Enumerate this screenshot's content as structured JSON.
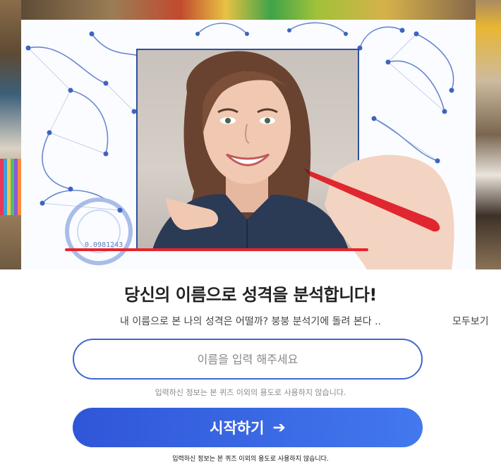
{
  "hero": {
    "gauge_readout": "0.0981243"
  },
  "title": "당신의 이름으로 성격을 분석합니다!",
  "subtitle": "내 이름으로 본 나의 성격은 어떨까? 붕붕 분석기에 돌려 본다 ..",
  "more_link": "모두보기",
  "name_input": {
    "value": "",
    "placeholder": "이름을 입력 해주세요"
  },
  "input_notice": "입력하신 정보는 본 퀴즈 이외의 용도로 사용하지 않습니다.",
  "start_button": {
    "label": "시작하기",
    "icon": "arrow-right-icon"
  },
  "footer_notice": "입력하신 정보는 본 퀴즈 이외의 용도로 사용하지 않습니다.",
  "colors": {
    "accent": "#3f67cf",
    "button_start": "#2f56d8",
    "button_end": "#4378ee",
    "pen_red": "#e8242b"
  }
}
